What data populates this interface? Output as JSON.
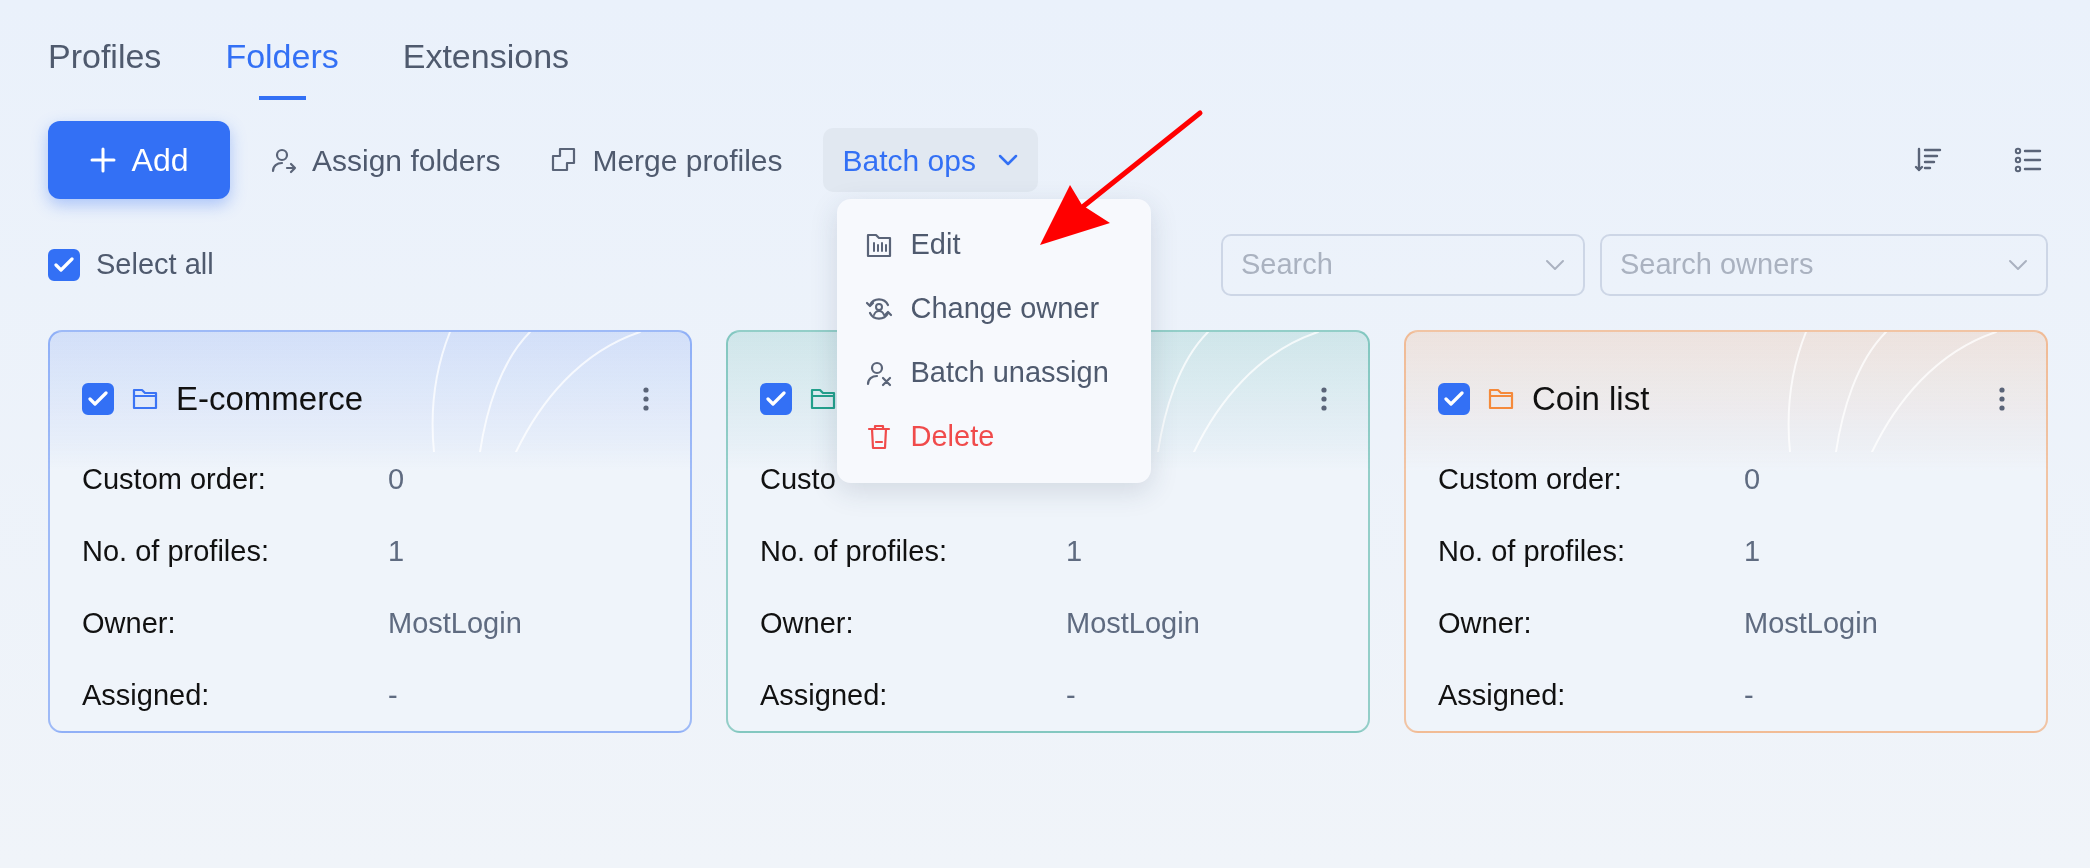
{
  "tabs": [
    {
      "label": "Profiles",
      "selected": false
    },
    {
      "label": "Folders",
      "selected": true
    },
    {
      "label": "Extensions",
      "selected": false
    }
  ],
  "toolbar": {
    "add_button": "Add",
    "actions": [
      {
        "kind": "assign",
        "label": "Assign folders"
      },
      {
        "kind": "merge",
        "label": "Merge profiles"
      }
    ],
    "batch_ops": {
      "label": "Batch ops",
      "expanded": true,
      "menu": [
        {
          "kind": "edit",
          "label": "Edit",
          "danger": false
        },
        {
          "kind": "owner",
          "label": "Change owner",
          "danger": false
        },
        {
          "kind": "unassign",
          "label": "Batch unassign",
          "danger": false
        },
        {
          "kind": "delete",
          "label": "Delete",
          "danger": true
        }
      ]
    }
  },
  "select_all": {
    "label": "Select all",
    "checked": true
  },
  "filters": [
    {
      "placeholder": "Search"
    },
    {
      "placeholder": "Search owners"
    }
  ],
  "folders": [
    {
      "title": "E-commerce",
      "color": "#3b74f5",
      "checked": true,
      "rows": [
        {
          "label": "Custom order:",
          "value": "0"
        },
        {
          "label": "No. of profiles:",
          "value": "1"
        },
        {
          "label": "Owner:",
          "value": "MostLogin"
        },
        {
          "label": "Assigned:",
          "value": "-"
        }
      ]
    },
    {
      "color": "#23a08c",
      "checked": true,
      "rows": [
        {
          "label": "Custo"
        },
        {
          "label": "No. of profiles:",
          "value": "1"
        },
        {
          "label": "Owner:",
          "value": "MostLogin"
        },
        {
          "label": "Assigned:",
          "value": "-"
        }
      ]
    },
    {
      "title": "Coin list",
      "color": "#f58a3b",
      "checked": true,
      "rows": [
        {
          "label": "Custom order:",
          "value": "0"
        },
        {
          "label": "No. of profiles:",
          "value": "1"
        },
        {
          "label": "Owner:",
          "value": "MostLogin"
        },
        {
          "label": "Assigned:",
          "value": "-"
        }
      ]
    }
  ],
  "annotation": {
    "kind": "arrow"
  }
}
